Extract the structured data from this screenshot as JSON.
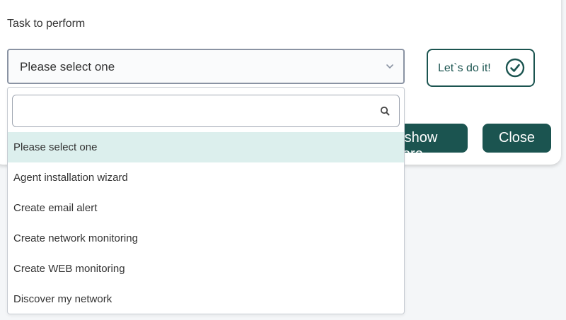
{
  "form": {
    "task_label": "Task to perform",
    "select_value": "Please select one"
  },
  "buttons": {
    "go_label": "Let`s do it!",
    "anymore_label": "Don't show anymore",
    "close_label": "Close"
  },
  "dropdown": {
    "search_value": "",
    "options": [
      "Please select one",
      "Agent installation wizard",
      "Create email alert",
      "Create network monitoring",
      "Create WEB monitoring",
      "Discover my network"
    ],
    "highlighted_index": 0
  },
  "colors": {
    "accent": "#1b5450",
    "highlight": "#dcefed",
    "background": "#f4f6f8"
  },
  "icons": {
    "chevron": "chevron-down-icon",
    "check": "check-circle-icon",
    "search": "search-icon"
  }
}
